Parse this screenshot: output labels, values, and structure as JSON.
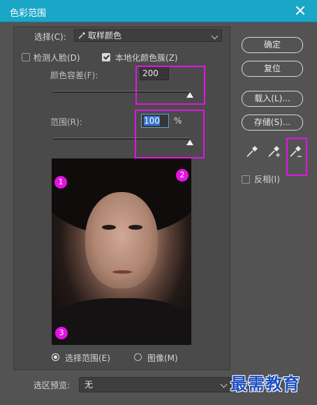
{
  "window": {
    "title": "色彩范围"
  },
  "select": {
    "label": "选择(C):",
    "value": "取样颜色"
  },
  "detect_faces": {
    "label": "检测人脸(D)",
    "checked": false
  },
  "localized_clusters": {
    "label": "本地化颜色簇(Z)",
    "checked": true
  },
  "fuzziness": {
    "label": "颜色容差(F):",
    "value": "200",
    "slider_fraction": 1.0
  },
  "range": {
    "label": "范围(R):",
    "value": "100",
    "unit": "%",
    "slider_fraction": 1.0
  },
  "buttons": {
    "ok": "确定",
    "reset": "复位",
    "load": "载入(L)...",
    "save": "存储(S)..."
  },
  "invert": {
    "label": "反相(I)",
    "checked": false
  },
  "preview_mode": {
    "selection_label": "选择范围(E)",
    "image_label": "图像(M)",
    "selected": "selection"
  },
  "selection_preview": {
    "label": "选区预览:",
    "value": "无"
  },
  "annotations": {
    "badge1": "1",
    "badge2": "2",
    "badge3": "3",
    "highlight_color": "#e313e3"
  },
  "icons": {
    "close": "close-icon",
    "eyedropper": "eyedropper-icon",
    "eyedropper_plus": "eyedropper-plus-icon",
    "eyedropper_minus": "eyedropper-minus-icon",
    "dropdown_eyedropper": "eyedropper-icon"
  },
  "watermark": "最需教育",
  "colors": {
    "titlebar": "#1aa6c7",
    "dialog_bg": "#535353",
    "accent": "#e313e3"
  }
}
